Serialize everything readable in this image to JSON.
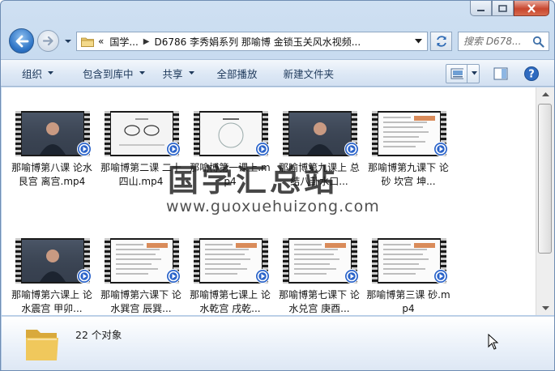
{
  "window": {
    "caption": {
      "minimize": "minimize",
      "maximize": "maximize",
      "close": "close"
    }
  },
  "address": {
    "overflow": "«",
    "crumbs": [
      "国学...",
      "D6786 李秀娟系列 那喻博 金锁玉关风水视频..."
    ]
  },
  "search": {
    "placeholder": "搜索 D678..."
  },
  "toolbar": {
    "organize": "组织",
    "include_library": "包含到库中",
    "share": "共享",
    "play_all": "全部播放",
    "new_folder": "新建文件夹"
  },
  "files": [
    {
      "name": "那喻博第八课 论水艮宫 离宫.mp4",
      "thumb": "person"
    },
    {
      "name": "那喻博第二课 二十四山.mp4",
      "thumb": "whiteboard"
    },
    {
      "name": "那喻博第一课上.mp4",
      "thumb": "diagram"
    },
    {
      "name": "那喻博第九课上 总结八卦水口...",
      "thumb": "person"
    },
    {
      "name": "那喻博第九课下 论砂 坎宫 坤...",
      "thumb": "doc"
    },
    {
      "name": "那喻博第六课上 论水震宫 甲卯...",
      "thumb": "person"
    },
    {
      "name": "那喻博第六课下 论水巽宫 辰巽...",
      "thumb": "doc"
    },
    {
      "name": "那喻博第七课上 论水乾宫 戌乾...",
      "thumb": "doc"
    },
    {
      "name": "那喻博第七课下 论水兑宫 庚酉...",
      "thumb": "doc"
    },
    {
      "name": "那喻博第三课 砂.mp4",
      "thumb": "doc"
    }
  ],
  "watermark": {
    "title": "国学汇总站",
    "url": "www.guoxuehuizong.com"
  },
  "details": {
    "count": "22 个对象"
  },
  "colors": {
    "accent": "#2e74c6",
    "badge": "#2a63c9"
  }
}
